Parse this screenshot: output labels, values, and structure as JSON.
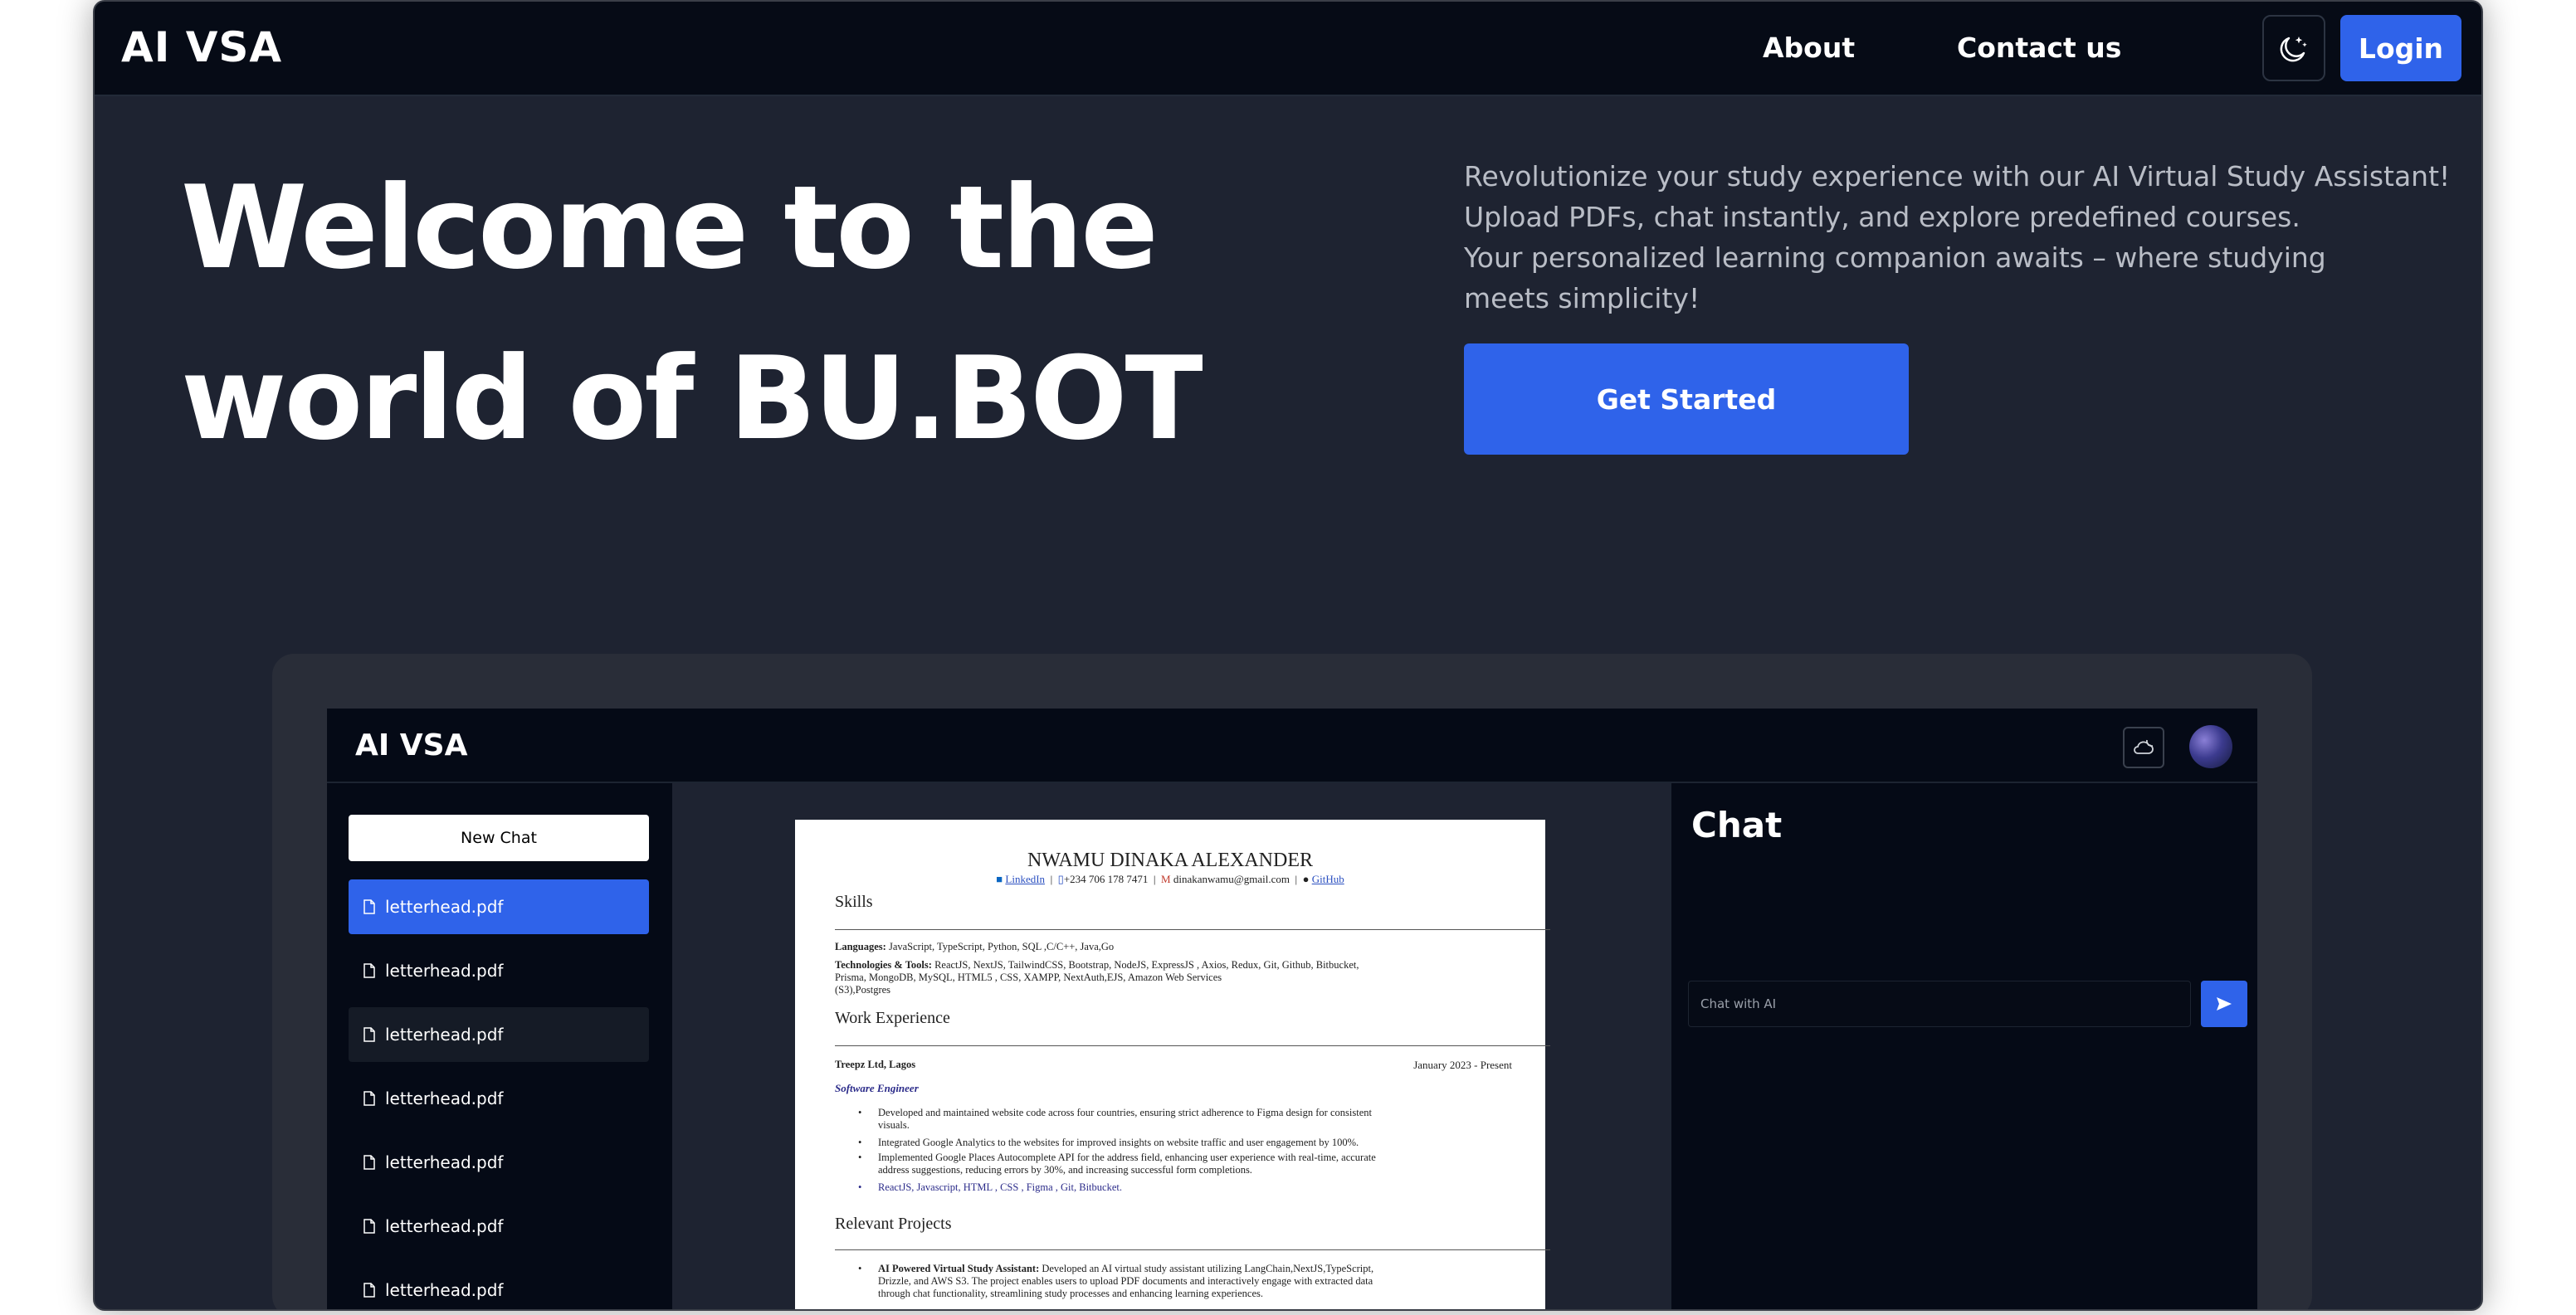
{
  "nav": {
    "brand": "AI VSA",
    "about": "About",
    "contact": "Contact us",
    "login": "Login"
  },
  "hero": {
    "title_line1": "Welcome to the",
    "title_line2": "world of BU.BOT",
    "desc": [
      "Revolutionize your study experience with our AI Virtual Study Assistant!",
      "Upload PDFs, chat instantly, and explore predefined courses.",
      "Your personalized learning companion awaits – where studying",
      "meets simplicity!"
    ],
    "cta": "Get Started"
  },
  "app": {
    "brand": "AI VSA",
    "new_chat": "New Chat",
    "files": [
      "letterhead.pdf",
      "letterhead.pdf",
      "letterhead.pdf",
      "letterhead.pdf",
      "letterhead.pdf",
      "letterhead.pdf",
      "letterhead.pdf"
    ],
    "chat_title": "Chat",
    "chat_placeholder": "Chat with AI"
  },
  "resume": {
    "name": "NWAMU DINAKA ALEXANDER",
    "linkedin": "LinkedIn",
    "phone": "+234 706 178 7471",
    "email": "dinakanwamu@gmail.com",
    "github": "GitHub",
    "skills_heading": "Skills",
    "languages_label": "Languages:",
    "languages": "JavaScript, TypeScript, Python, SQL ,C/C++, Java,Go",
    "tech_label": "Technologies & Tools:",
    "tech_line1": "ReactJS, NextJS, TailwindCSS, Bootstrap, NodeJS, ExpressJS , Axios, Redux, Git, Github, Bitbucket,",
    "tech_line2": "Prisma, MongoDB, MySQL, HTML5 , CSS, XAMPP, NextAuth,EJS, Amazon Web Services",
    "tech_line3": "(S3),Postgres",
    "work_heading": "Work Experience",
    "company": "Treepz Ltd, Lagos",
    "dates": "January 2023 - Present",
    "role": "Software Engineer",
    "bullets": [
      "Developed and maintained website code across four countries, ensuring strict adherence to Figma design for consistent",
      "visuals.",
      "Integrated Google Analytics to the websites for improved insights on website traffic and user engagement by 100%.",
      "Implemented Google Places Autocomplete API for the address field, enhancing user experience with real-time, accurate",
      "address suggestions, reducing errors by 30%, and increasing successful form completions.",
      "ReactJS, Javascript, HTML , CSS , Figma , Git, Bitbucket."
    ],
    "projects_heading": "Relevant Projects",
    "project_label": "AI Powered Virtual Study Assistant:",
    "project_line1": "Developed an AI virtual study assistant utilizing LangChain,NextJS,TypeScript,",
    "project_line2": "Drizzle, and AWS S3. The project enables users to upload PDF documents and interactively engage with extracted data",
    "project_line3": "through chat functionality, streamlining study processes and enhancing learning experiences."
  }
}
